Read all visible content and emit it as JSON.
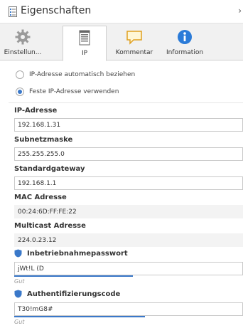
{
  "window": {
    "title": "Eigenschaften",
    "chevron": "›"
  },
  "tabs": [
    {
      "label": "Einstellun...",
      "icon": "gear-icon"
    },
    {
      "label": "IP",
      "icon": "ip-list-icon"
    },
    {
      "label": "Kommentar",
      "icon": "comment-icon"
    },
    {
      "label": "Information",
      "icon": "info-icon"
    }
  ],
  "ip_mode": {
    "auto_label": "IP-Adresse automatisch beziehen",
    "fixed_label": "Feste IP-Adresse verwenden",
    "selected": "fixed"
  },
  "fields": {
    "ip_address": {
      "label": "IP-Adresse",
      "value": "192.168.1.31"
    },
    "subnet_mask": {
      "label": "Subnetzmaske",
      "value": "255.255.255.0"
    },
    "gateway": {
      "label": "Standardgateway",
      "value": "192.168.1.1"
    },
    "mac": {
      "label": "MAC Adresse",
      "value": "00:24:6D:FF:FE:22"
    },
    "multicast": {
      "label": "Multicast Adresse",
      "value": "224.0.23.12"
    },
    "commissioning_password": {
      "label": "Inbetriebnahmepasswort",
      "value": "jWt!L (D",
      "strength_label": "Gut",
      "strength": 0.52
    },
    "auth_code": {
      "label": "Authentifizierungscode",
      "value": "T30!mG8#",
      "strength_label": "Gut",
      "strength": 0.57
    }
  },
  "colors": {
    "accent": "#3a78c9",
    "shield": "#3a78c9"
  }
}
